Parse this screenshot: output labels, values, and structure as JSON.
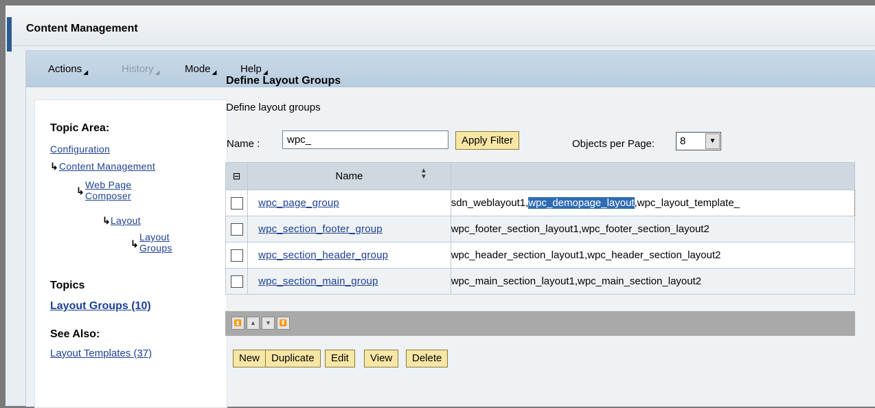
{
  "window": {
    "title": "Content Management"
  },
  "menubar": [
    {
      "label": "Actions",
      "enabled": true
    },
    {
      "label": "History",
      "enabled": false
    },
    {
      "label": "Mode",
      "enabled": true
    },
    {
      "label": "Help",
      "enabled": true
    }
  ],
  "nav": {
    "topic_area_heading": "Topic Area:",
    "breadcrumb": {
      "configuration": "Configuration",
      "content_management": "Content Management",
      "web_page_line1": "Web Page",
      "web_page_line2": "Composer",
      "layout": "Layout",
      "layout_groups_line1": "Layout",
      "layout_groups_line2": "Groups"
    },
    "topics_heading": "Topics",
    "topics_link": "Layout Groups (10)",
    "see_also_heading": "See Also:",
    "see_also_link": "Layout Templates (37)"
  },
  "main": {
    "title": "Define Layout Groups",
    "description": "Define layout groups",
    "filter": {
      "name_label": "Name :",
      "name_value": "wpc_",
      "apply_label": "Apply Filter",
      "objects_per_page_label": "Objects per Page:",
      "objects_per_page_value": "8"
    },
    "table": {
      "header_name": "Name",
      "rows": [
        {
          "name": "wpc_page_group",
          "value_before": "sdn_weblayout1,",
          "value_highlight": "wpc_demopage_layout",
          "value_after": ",wpc_layout_template_"
        },
        {
          "name": "wpc_section_footer_group",
          "value": "wpc_footer_section_layout1,wpc_footer_section_layout2"
        },
        {
          "name": "wpc_section_header_group",
          "value": "wpc_header_section_layout1,wpc_header_section_layout2"
        },
        {
          "name": "wpc_section_main_group",
          "value": "wpc_main_section_layout1,wpc_main_section_layout2"
        }
      ]
    },
    "actions": {
      "new": "New",
      "duplicate": "Duplicate",
      "edit": "Edit",
      "view": "View",
      "delete": "Delete"
    }
  },
  "colors": {
    "accent": "#2a5b8f",
    "link": "#1c3f93",
    "button": "#f8e6a5",
    "selection": "#2f6cb4"
  }
}
